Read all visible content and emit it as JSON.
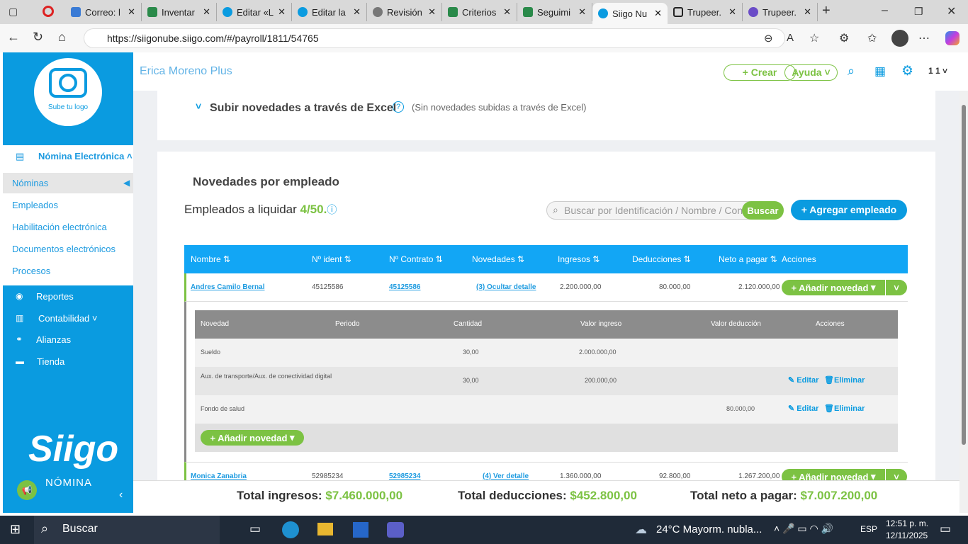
{
  "browser": {
    "tabs": [
      {
        "label": "Correo: l"
      },
      {
        "label": "Inventar"
      },
      {
        "label": "Editar «L"
      },
      {
        "label": "Editar la"
      },
      {
        "label": "Revisión"
      },
      {
        "label": "Criterios"
      },
      {
        "label": "Seguimi"
      },
      {
        "label": "Siigo Nu"
      },
      {
        "label": "Trupeer."
      },
      {
        "label": "Trupeer."
      }
    ],
    "url": "https://siigonube.siigo.com/#/payroll/1811/54765"
  },
  "sidebar": {
    "logo_text": "Sube tu logo",
    "section": "Nómina Electrónica",
    "items": [
      "Nóminas",
      "Empleados",
      "Habilitación electrónica",
      "Documentos electrónicos",
      "Procesos"
    ],
    "main_items": [
      "Reportes",
      "Contabilidad",
      "Alianzas",
      "Tienda"
    ],
    "brand": "Siigo",
    "brand_sub": "NÓMINA"
  },
  "header": {
    "company": "Erica Moreno Plus",
    "crear": "+ Crear",
    "ayuda": "Ayuda",
    "user": "1 1"
  },
  "excel": {
    "title": "Subir novedades a través de Excel",
    "note": "(Sin novedades subidas a través de Excel)"
  },
  "novedades": {
    "title": "Novedades por empleado",
    "liquidar_label": "Empleados a liquidar",
    "liquidar_value": "4/50.",
    "search_placeholder": "Buscar por Identificación / Nombre / Concepto",
    "buscar": "Buscar",
    "agregar": "+ Agregar empleado"
  },
  "table": {
    "headers": [
      "Nombre ⇅",
      "Nº ident ⇅",
      "Nº Contrato ⇅",
      "Novedades ⇅",
      "Ingresos ⇅",
      "Deducciones ⇅",
      "Neto a pagar ⇅",
      "Acciones"
    ],
    "rows": [
      {
        "nombre": "Andres Camilo Bernal",
        "ident": "45125586",
        "contrato": "45125586",
        "novedades": "(3) Ocultar detalle",
        "ingresos": "2.200.000,00",
        "deducciones": "80.000,00",
        "neto": "2.120.000,00"
      },
      {
        "nombre": "Monica Zanabria",
        "ident": "52985234",
        "contrato": "52985234",
        "novedades": "(4) Ver detalle",
        "ingresos": "1.360.000,00",
        "deducciones": "92.800,00",
        "neto": "1.267.200,00"
      }
    ],
    "add_novedad": "+ Añadir novedad"
  },
  "detail": {
    "headers": [
      "Novedad",
      "Periodo",
      "Cantidad",
      "Valor ingreso",
      "Valor deducción",
      "Acciones"
    ],
    "rows": [
      {
        "novedad": "Sueldo",
        "cantidad": "30,00",
        "ingreso": "2.000.000,00",
        "deduccion": ""
      },
      {
        "novedad": "Aux. de transporte/Aux. de conectividad digital",
        "cantidad": "30,00",
        "ingreso": "200.000,00",
        "deduccion": ""
      },
      {
        "novedad": "Fondo de salud",
        "cantidad": "",
        "ingreso": "",
        "deduccion": "80.000,00"
      }
    ],
    "editar": "Editar",
    "eliminar": "Eliminar",
    "add": "+ Añadir novedad"
  },
  "totals": {
    "ingresos_label": "Total ingresos:",
    "ingresos": "$7.460.000,00",
    "deducciones_label": "Total deducciones:",
    "deducciones": "$452.800,00",
    "neto_label": "Total neto a pagar:",
    "neto": "$7.007.200,00"
  },
  "taskbar": {
    "search": "Buscar",
    "weather": "24°C  Mayorm. nubla...",
    "lang": "ESP",
    "time": "12:51 p. m.",
    "date": "12/11/2025"
  }
}
